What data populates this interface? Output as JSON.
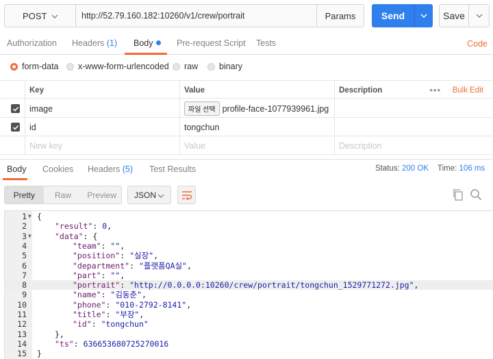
{
  "request": {
    "method": "POST",
    "url": "http://52.79.160.182:10260/v1/crew/portrait",
    "params_label": "Params",
    "send_label": "Send",
    "save_label": "Save"
  },
  "request_tabs": {
    "authorization": "Authorization",
    "headers": "Headers",
    "headers_count": "(1)",
    "body": "Body",
    "pre_request": "Pre-request Script",
    "tests": "Tests",
    "code": "Code"
  },
  "body_types": [
    "form-data",
    "x-www-form-urlencoded",
    "raw",
    "binary"
  ],
  "body_type_selected": "form-data",
  "form_table": {
    "headers": {
      "key": "Key",
      "value": "Value",
      "description": "Description",
      "more": "•••",
      "bulk_edit": "Bulk Edit"
    },
    "rows": [
      {
        "key": "image",
        "file_button": "파일 선택",
        "value": "profile-face-1077939961.jpg",
        "description": ""
      },
      {
        "key": "id",
        "file_button": "",
        "value": "tongchun",
        "description": ""
      }
    ],
    "new_row": {
      "key": "New key",
      "value": "Value",
      "description": "Description"
    }
  },
  "response_tabs": {
    "body": "Body",
    "cookies": "Cookies",
    "headers": "Headers",
    "headers_count": "(5)",
    "test_results": "Test Results",
    "status_label": "Status:",
    "status_value": "200 OK",
    "time_label": "Time:",
    "time_value": "106 ms"
  },
  "response_toolbar": {
    "views": [
      "Pretty",
      "Raw",
      "Preview"
    ],
    "selected_view": "Pretty",
    "format": "JSON"
  },
  "response_lines": [
    {
      "n": "1",
      "fold": true,
      "indent": 0,
      "key": "",
      "value": "",
      "vtype": "",
      "open": "{",
      "tail": ""
    },
    {
      "n": "2",
      "fold": false,
      "indent": 1,
      "key": "\"result\"",
      "value": "0",
      "vtype": "n",
      "open": "",
      "tail": ","
    },
    {
      "n": "3",
      "fold": true,
      "indent": 1,
      "key": "\"data\"",
      "value": "",
      "vtype": "",
      "open": "{",
      "tail": ""
    },
    {
      "n": "4",
      "fold": false,
      "indent": 2,
      "key": "\"team\"",
      "value": "\"\"",
      "vtype": "s",
      "open": "",
      "tail": ","
    },
    {
      "n": "5",
      "fold": false,
      "indent": 2,
      "key": "\"position\"",
      "value": "\"실장\"",
      "vtype": "s",
      "open": "",
      "tail": ","
    },
    {
      "n": "6",
      "fold": false,
      "indent": 2,
      "key": "\"department\"",
      "value": "\"플랫폼QA실\"",
      "vtype": "s",
      "open": "",
      "tail": ","
    },
    {
      "n": "7",
      "fold": false,
      "indent": 2,
      "key": "\"part\"",
      "value": "\"\"",
      "vtype": "s",
      "open": "",
      "tail": ","
    },
    {
      "n": "8",
      "fold": false,
      "indent": 2,
      "key": "\"portrait\"",
      "value": "\"http://0.0.0.0:10260/crew/portrait/tongchun_1529771272.jpg\"",
      "vtype": "s",
      "open": "",
      "tail": ",",
      "highlight": true
    },
    {
      "n": "9",
      "fold": false,
      "indent": 2,
      "key": "\"name\"",
      "value": "\"김동춘\"",
      "vtype": "s",
      "open": "",
      "tail": ","
    },
    {
      "n": "10",
      "fold": false,
      "indent": 2,
      "key": "\"phone\"",
      "value": "\"010-2792-8141\"",
      "vtype": "s",
      "open": "",
      "tail": ","
    },
    {
      "n": "11",
      "fold": false,
      "indent": 2,
      "key": "\"title\"",
      "value": "\"부장\"",
      "vtype": "s",
      "open": "",
      "tail": ","
    },
    {
      "n": "12",
      "fold": false,
      "indent": 2,
      "key": "\"id\"",
      "value": "\"tongchun\"",
      "vtype": "s",
      "open": "",
      "tail": ""
    },
    {
      "n": "13",
      "fold": false,
      "indent": 1,
      "key": "",
      "value": "",
      "vtype": "",
      "open": "},",
      "tail": ""
    },
    {
      "n": "14",
      "fold": false,
      "indent": 1,
      "key": "\"ts\"",
      "value": "636653680725270016",
      "vtype": "n",
      "open": "",
      "tail": ""
    },
    {
      "n": "15",
      "fold": false,
      "indent": 0,
      "key": "",
      "value": "",
      "vtype": "",
      "open": "}",
      "tail": ""
    }
  ],
  "colors": {
    "accent": "#f26b3a",
    "primary": "#2f80ed"
  }
}
